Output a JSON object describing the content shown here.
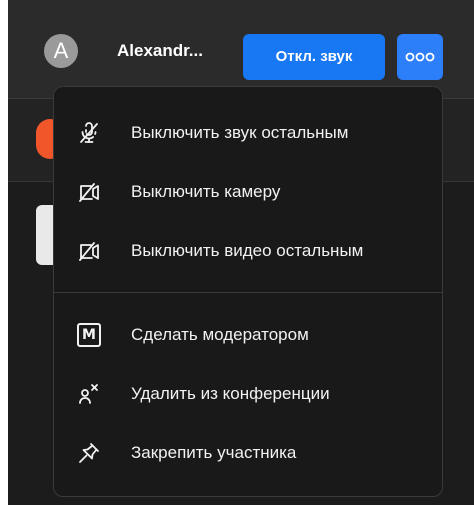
{
  "participant": {
    "avatar_letter": "A",
    "name": "Alexandr..."
  },
  "toolbar": {
    "mute_label": "Откл. звук",
    "more_icon": "more-dots-icon",
    "accent_color": "#1877f2"
  },
  "menu": {
    "items": [
      {
        "label": "Выключить звук остальным",
        "icon": "mic-off-icon"
      },
      {
        "label": "Выключить камеру",
        "icon": "camera-off-icon"
      },
      {
        "label": "Выключить видео остальным",
        "icon": "camera-off-icon"
      },
      {
        "label": "Сделать модератором",
        "icon": "moderator-icon",
        "icon_text": "M"
      },
      {
        "label": "Удалить из конференции",
        "icon": "remove-user-icon"
      },
      {
        "label": "Закрепить участника",
        "icon": "pin-icon"
      }
    ]
  }
}
